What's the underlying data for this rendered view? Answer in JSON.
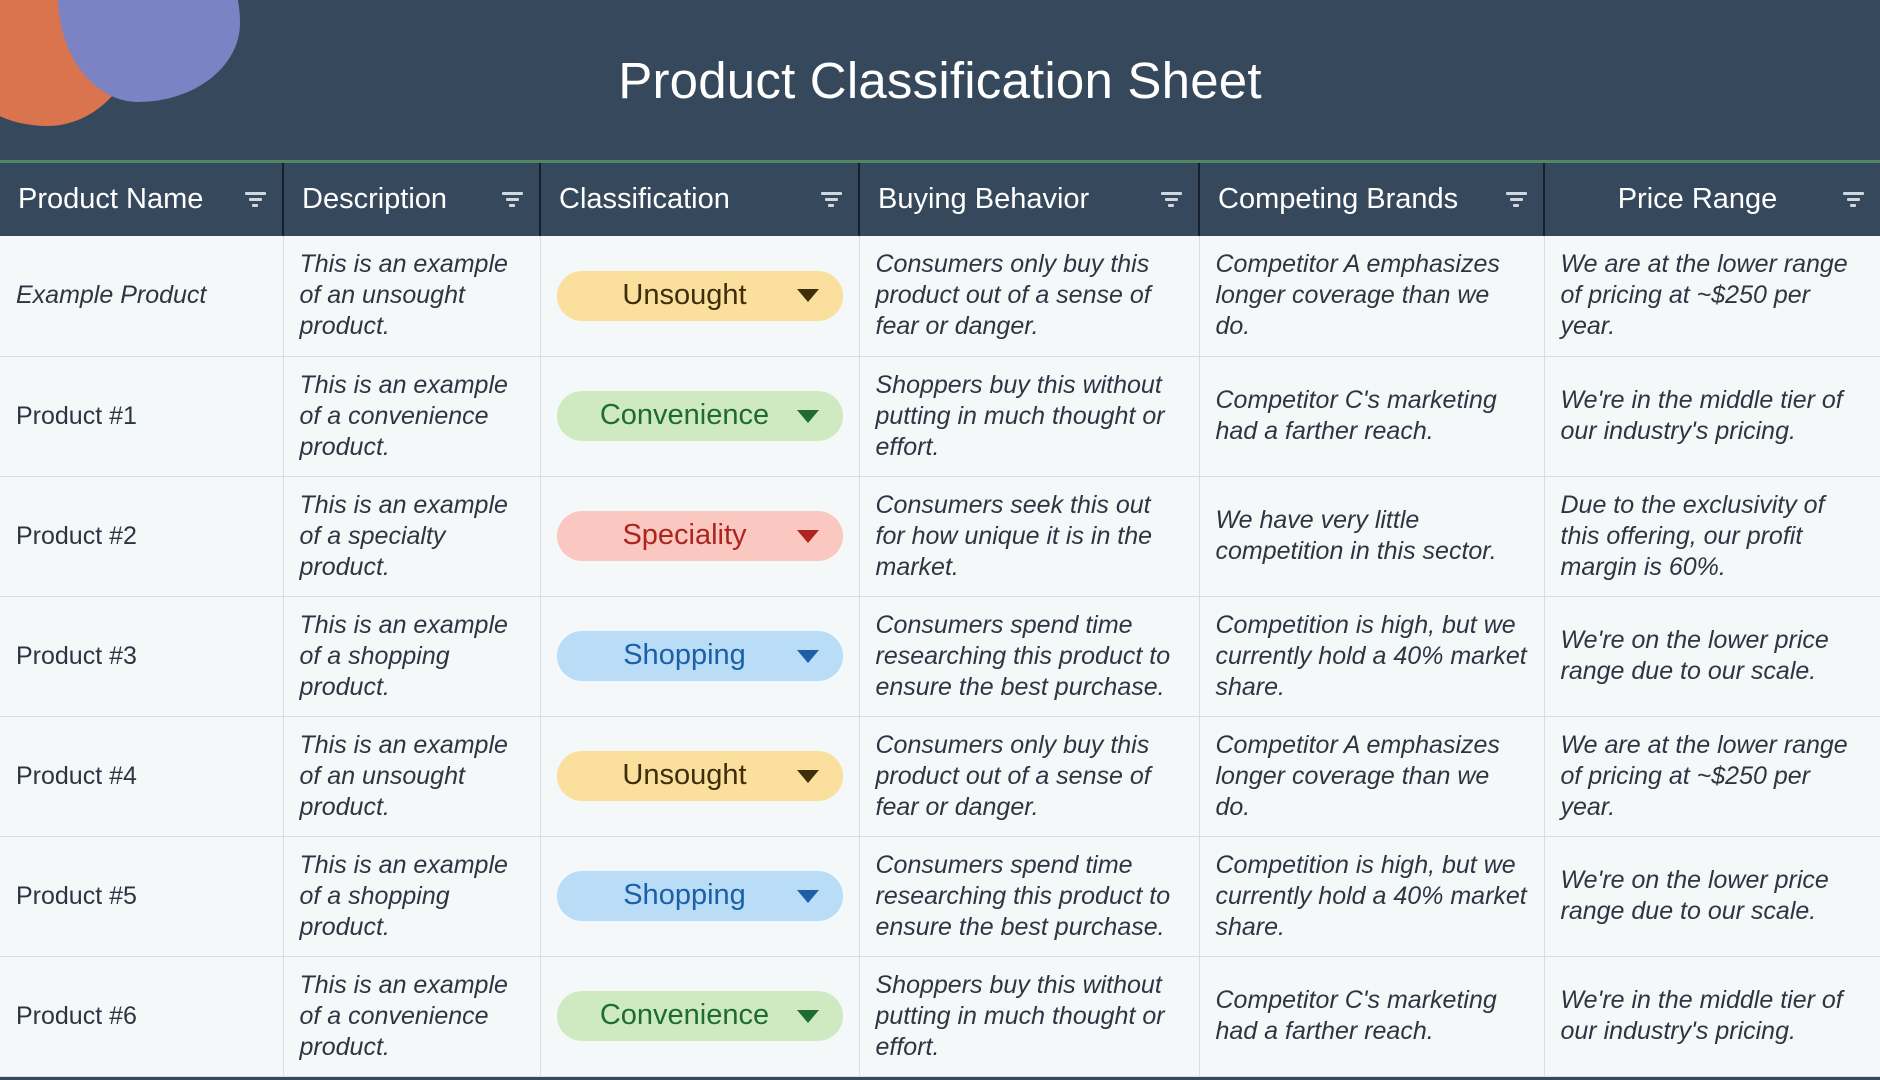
{
  "header": {
    "title": "Product Classification Sheet",
    "accent_color": "#4e8668",
    "background_color": "#36495c",
    "blob_colors": {
      "orange": "#d9744f",
      "purple": "#7b83c4"
    }
  },
  "table": {
    "columns": [
      {
        "label": "Product Name",
        "filter_icon": "filter-icon"
      },
      {
        "label": "Description",
        "filter_icon": "filter-icon"
      },
      {
        "label": "Classification",
        "filter_icon": "filter-icon"
      },
      {
        "label": "Buying Behavior",
        "filter_icon": "filter-icon"
      },
      {
        "label": "Competing Brands",
        "filter_icon": "filter-icon"
      },
      {
        "label": "Price Range",
        "filter_icon": "filter-icon"
      }
    ],
    "classification_styles": {
      "Unsought": {
        "background": "#fbdf9d",
        "text": "#3f2d0c"
      },
      "Convenience": {
        "background": "#cfeac0",
        "text": "#1e6b34"
      },
      "Speciality": {
        "background": "#fac8c1",
        "text": "#ad241f"
      },
      "Shopping": {
        "background": "#b9dcf7",
        "text": "#1c5fa8"
      }
    },
    "rows": [
      {
        "name": "Example Product",
        "name_italic": true,
        "description": "This is an example of an unsought product.",
        "classification": "Unsought",
        "classification_key": "unsought",
        "buying_behavior": "Consumers only buy this product out of a sense of fear or danger.",
        "competing_brands": "Competitor A emphasizes longer coverage than we do.",
        "price_range": "We are at the lower range of pricing at ~$250 per year."
      },
      {
        "name": "Product #1",
        "name_italic": false,
        "description": "This is an example of a convenience product.",
        "classification": "Convenience",
        "classification_key": "convenience",
        "buying_behavior": "Shoppers buy this without putting in much thought or effort.",
        "competing_brands": "Competitor C's marketing had a farther reach.",
        "price_range": "We're in the middle tier of our industry's pricing."
      },
      {
        "name": "Product #2",
        "name_italic": false,
        "description": "This is an example of a specialty product.",
        "classification": "Speciality",
        "classification_key": "speciality",
        "buying_behavior": "Consumers seek this out for how unique it is in the market.",
        "competing_brands": "We have very little competition in this sector.",
        "price_range": "Due to the exclusivity of this offering, our profit margin is 60%."
      },
      {
        "name": "Product #3",
        "name_italic": false,
        "description": "This is an example of a shopping product.",
        "classification": "Shopping",
        "classification_key": "shopping",
        "buying_behavior": "Consumers spend time researching this product to ensure the best purchase.",
        "competing_brands": "Competition is high, but we currently hold a 40% market share.",
        "price_range": "We're on the lower price range due to our scale."
      },
      {
        "name": "Product #4",
        "name_italic": false,
        "description": "This is an example of an unsought product.",
        "classification": "Unsought",
        "classification_key": "unsought",
        "buying_behavior": "Consumers only buy this product out of a sense of fear or danger.",
        "competing_brands": "Competitor A emphasizes longer coverage than we do.",
        "price_range": "We are at the lower range of pricing at ~$250 per year."
      },
      {
        "name": "Product #5",
        "name_italic": false,
        "description": "This is an example of a shopping product.",
        "classification": "Shopping",
        "classification_key": "shopping",
        "buying_behavior": "Consumers spend time researching this product to ensure the best purchase.",
        "competing_brands": "Competition is high, but we currently hold a 40% market share.",
        "price_range": "We're on the lower price range due to our scale."
      },
      {
        "name": "Product #6",
        "name_italic": false,
        "description": "This is an example of a convenience product.",
        "classification": "Convenience",
        "classification_key": "convenience",
        "buying_behavior": "Shoppers buy this without putting in much thought or effort.",
        "competing_brands": "Competitor C's marketing had a farther reach.",
        "price_range": "We're in the middle tier of our industry's pricing."
      }
    ]
  }
}
